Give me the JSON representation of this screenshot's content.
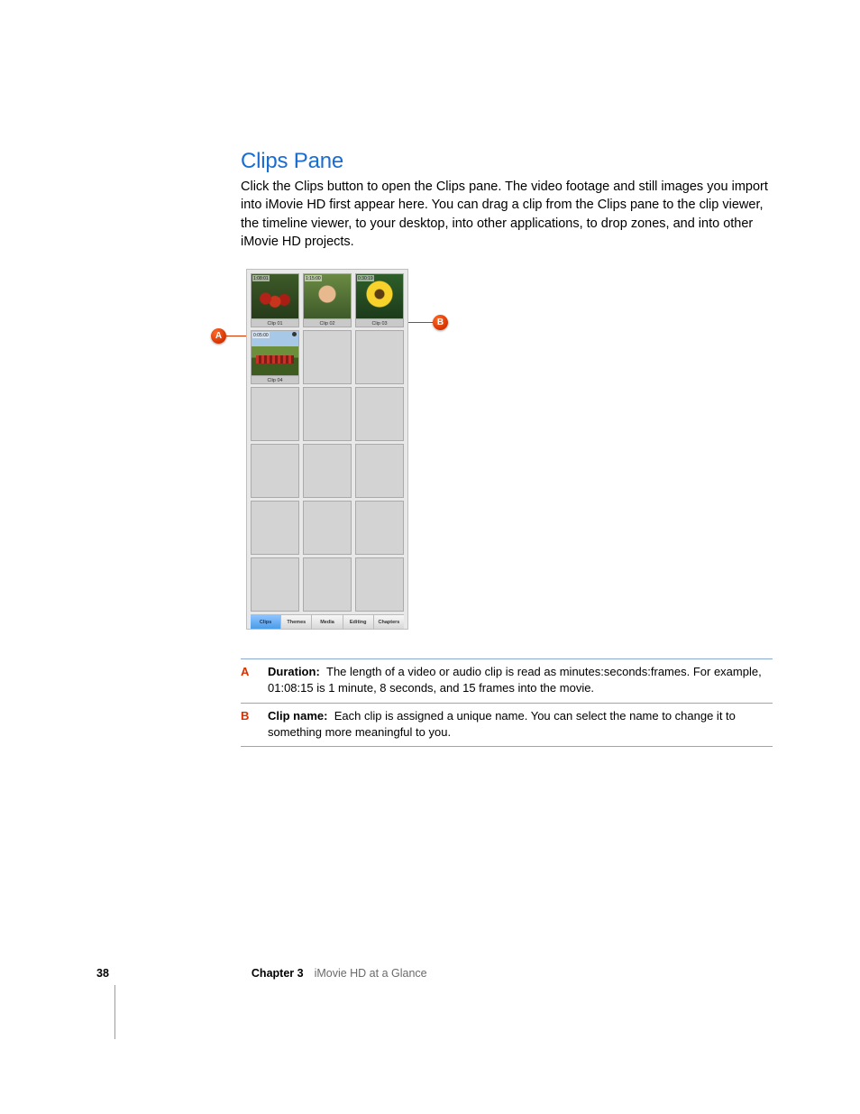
{
  "heading": "Clips Pane",
  "body": "Click the Clips button to open the Clips pane. The video footage and still images you import into iMovie HD first appear here. You can drag a clip from the Clips pane to the clip viewer, the timeline viewer, to your desktop, into other applications, to drop zones, and into other iMovie HD projects.",
  "clips": [
    {
      "duration": "1:08:01",
      "name": "Clip 01",
      "thumb": "thumb-apples"
    },
    {
      "duration": "1:15:00",
      "name": "Clip 02",
      "thumb": "thumb-girl"
    },
    {
      "duration": "0:30:19",
      "name": "Clip 03",
      "thumb": "thumb-sunflower"
    },
    {
      "duration": "0:05:00",
      "name": "Clip 04",
      "thumb": "thumb-field",
      "audio": true
    }
  ],
  "empty_rows": 4,
  "tabs": [
    {
      "label": "Clips",
      "active": true
    },
    {
      "label": "Themes",
      "active": false
    },
    {
      "label": "Media",
      "active": false
    },
    {
      "label": "Editing",
      "active": false
    },
    {
      "label": "Chapters",
      "active": false
    }
  ],
  "callouts": {
    "A": {
      "term": "Duration:",
      "desc": "The length of a video or audio clip is read as minutes:seconds:frames. For example, 01:08:15 is 1 minute, 8 seconds, and 15 frames into the movie."
    },
    "B": {
      "term": "Clip name:",
      "desc": "Each clip is assigned a unique name. You can select the name to change it to something more meaningful to you."
    }
  },
  "badge_a": "A",
  "badge_b": "B",
  "footer": {
    "page": "38",
    "chapter": "Chapter 3",
    "title": "iMovie HD at a Glance"
  }
}
